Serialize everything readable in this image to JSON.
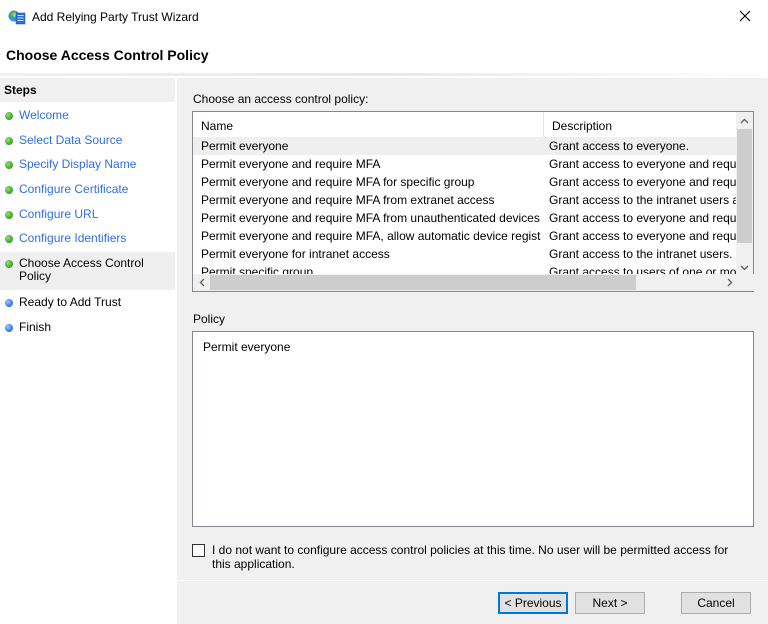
{
  "window": {
    "title": "Add Relying Party Trust Wizard",
    "icon": "wizard-app-icon",
    "close_icon": "close-icon"
  },
  "page": {
    "title": "Choose Access Control Policy"
  },
  "sidebar": {
    "title": "Steps",
    "steps": [
      {
        "label": "Welcome",
        "status": "done"
      },
      {
        "label": "Select Data Source",
        "status": "done"
      },
      {
        "label": "Specify Display Name",
        "status": "done"
      },
      {
        "label": "Configure Certificate",
        "status": "done"
      },
      {
        "label": "Configure URL",
        "status": "done"
      },
      {
        "label": "Configure Identifiers",
        "status": "done"
      },
      {
        "label": "Choose Access Control Policy",
        "status": "current"
      },
      {
        "label": "Ready to Add Trust",
        "status": "todo"
      },
      {
        "label": "Finish",
        "status": "todo"
      }
    ]
  },
  "main": {
    "choose_label": "Choose an access control policy:",
    "list": {
      "columns": [
        "Name",
        "Description"
      ],
      "rows": [
        {
          "name": "Permit everyone",
          "description": "Grant access to everyone.",
          "selected": true
        },
        {
          "name": "Permit everyone and require MFA",
          "description": "Grant access to everyone and requir",
          "selected": false
        },
        {
          "name": "Permit everyone and require MFA for specific group",
          "description": "Grant access to everyone and requir",
          "selected": false
        },
        {
          "name": "Permit everyone and require MFA from extranet access",
          "description": "Grant access to the intranet users ar",
          "selected": false
        },
        {
          "name": "Permit everyone and require MFA from unauthenticated devices",
          "description": "Grant access to everyone and requir",
          "selected": false
        },
        {
          "name": "Permit everyone and require MFA, allow automatic device registr...",
          "description": "Grant access to everyone and requir",
          "selected": false
        },
        {
          "name": "Permit everyone for intranet access",
          "description": "Grant access to the intranet users.",
          "selected": false
        },
        {
          "name": "Permit specific group",
          "description": "Grant access to users of one or more",
          "selected": false
        }
      ],
      "scroll": {
        "up": "^",
        "down": "v",
        "left": "<",
        "right": ">"
      }
    },
    "policy_label": "Policy",
    "policy_text": "Permit everyone",
    "checkbox": {
      "label": "I do not want to configure access control policies at this time.  No user will be permitted access for this application.",
      "checked": false
    }
  },
  "buttons": {
    "previous": "< Previous",
    "next": "Next >",
    "cancel": "Cancel"
  }
}
